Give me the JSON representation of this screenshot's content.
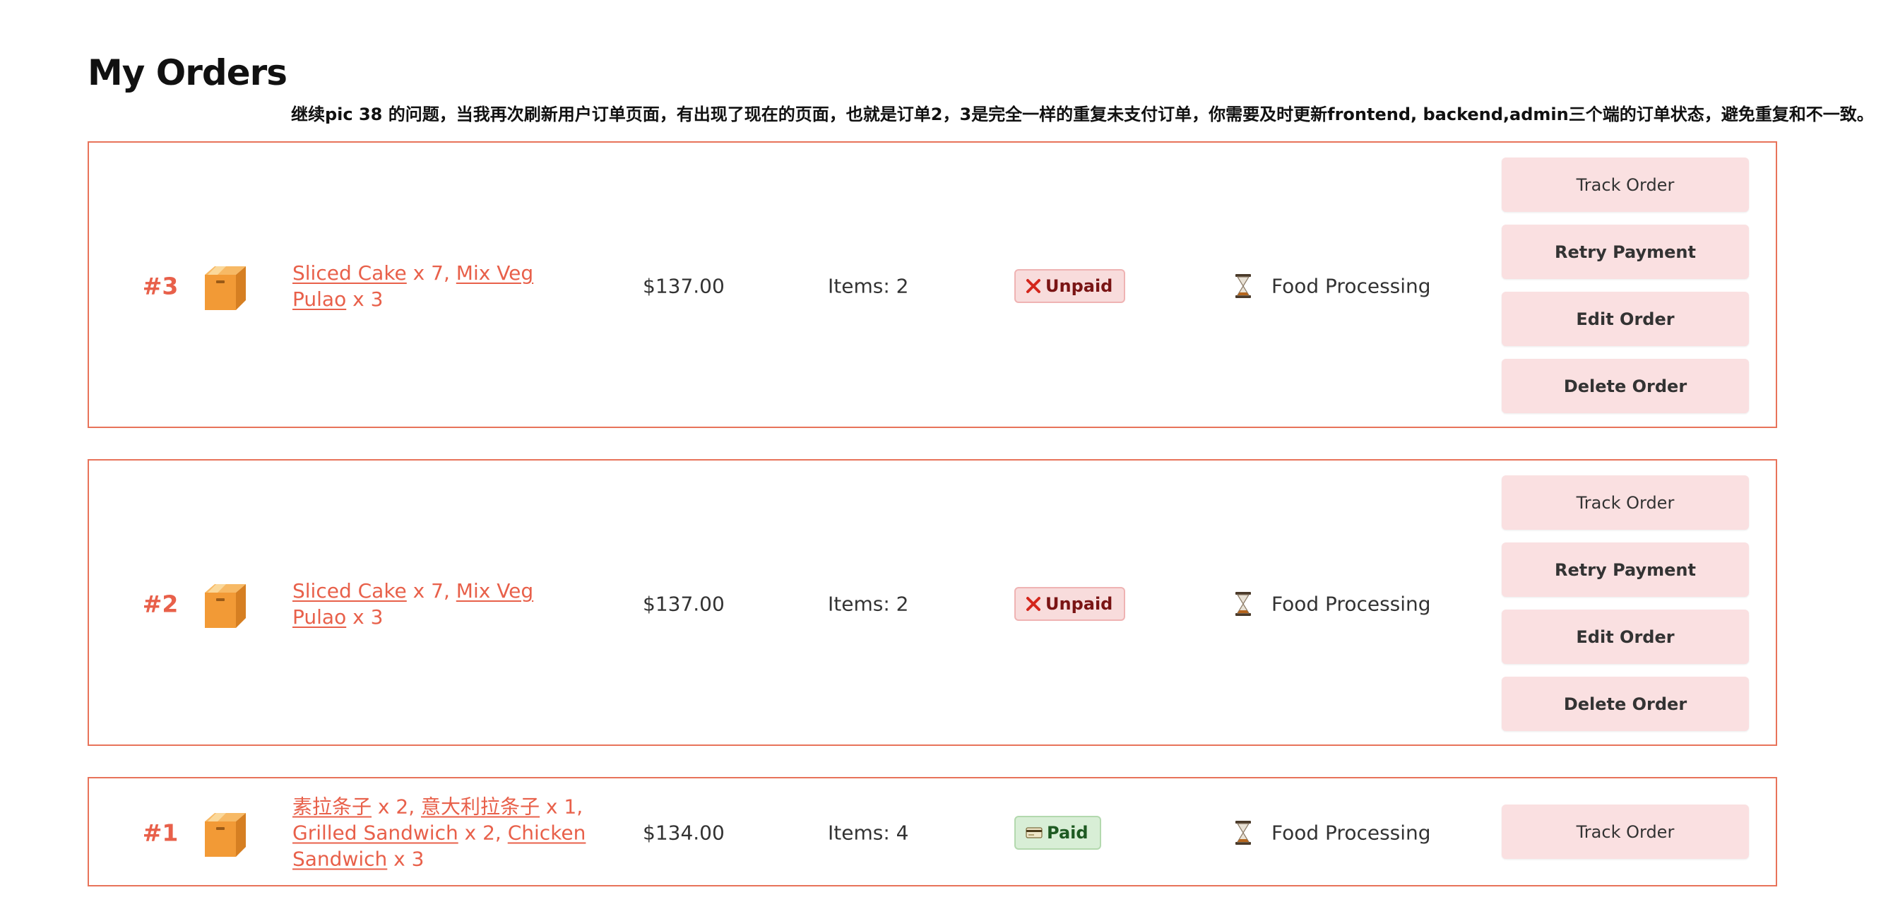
{
  "page": {
    "title": "My Orders",
    "note": "继续pic 38 的问题，当我再次刷新用户订单页面，有出现了现在的页面，也就是订单2，3是完全一样的重复未支付订单，你需要及时更新frontend, backend,admin三个端的订单状态，避免重复和不一致。"
  },
  "colors": {
    "accent": "#e8604a",
    "card_border": "#e8735a",
    "button_bg": "#fae0e1",
    "unpaid_bg": "#f8dcdc",
    "paid_bg": "#d8eed6"
  },
  "orders": [
    {
      "id": "#3",
      "items": [
        {
          "name": "Sliced Cake",
          "qty": " x 7, "
        },
        {
          "name": "Mix Veg Pulao",
          "qty": " x 3"
        }
      ],
      "price": "$137.00",
      "count": "Items: 2",
      "payment": {
        "label": "Unpaid",
        "icon": "x-icon"
      },
      "status": {
        "label": "Food Processing",
        "icon": "hourglass-icon"
      },
      "buttons": {
        "track": "Track Order",
        "retry": "Retry Payment",
        "edit": "Edit Order",
        "delete": "Delete Order"
      }
    },
    {
      "id": "#2",
      "items": [
        {
          "name": "Sliced Cake",
          "qty": " x 7, "
        },
        {
          "name": "Mix Veg Pulao",
          "qty": " x 3"
        }
      ],
      "price": "$137.00",
      "count": "Items: 2",
      "payment": {
        "label": "Unpaid",
        "icon": "x-icon"
      },
      "status": {
        "label": "Food Processing",
        "icon": "hourglass-icon"
      },
      "buttons": {
        "track": "Track Order",
        "retry": "Retry Payment",
        "edit": "Edit Order",
        "delete": "Delete Order"
      }
    },
    {
      "id": "#1",
      "items": [
        {
          "name": "素拉条子",
          "qty": " x 2, "
        },
        {
          "name": "意大利拉条子",
          "qty": " x 1, "
        },
        {
          "name": "Grilled Sandwich",
          "qty": " x 2, "
        },
        {
          "name": "Chicken Sandwich",
          "qty": " x 3"
        }
      ],
      "price": "$134.00",
      "count": "Items: 4",
      "payment": {
        "label": "Paid",
        "icon": "credit-card-icon"
      },
      "status": {
        "label": "Food Processing",
        "icon": "hourglass-icon"
      },
      "buttons": {
        "track": "Track Order"
      }
    }
  ]
}
